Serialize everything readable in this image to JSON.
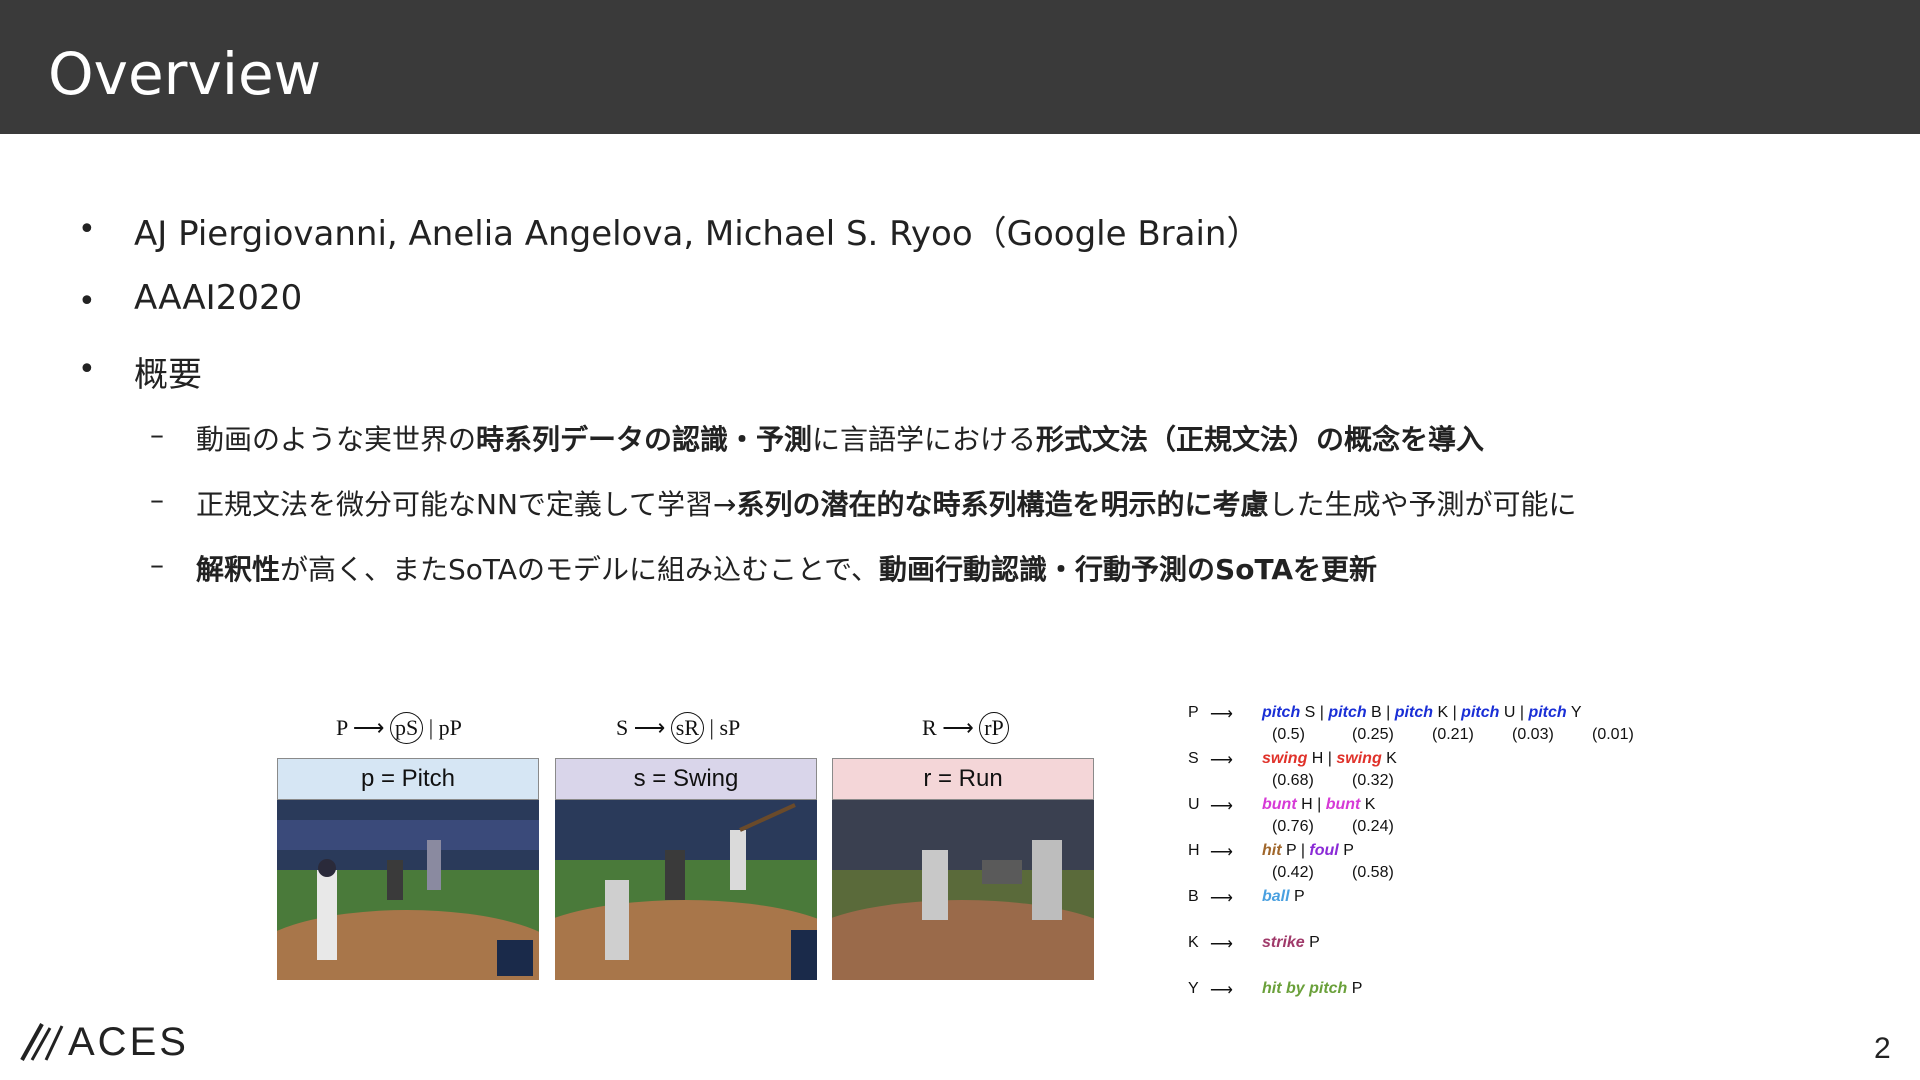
{
  "header": {
    "title": "Overview"
  },
  "bullets": [
    "AJ Piergiovanni, Anelia Angelova, Michael S. Ryoo（Google Brain）",
    "AAAI2020",
    "概要"
  ],
  "sub_bullets": [
    [
      {
        "t": "動画のような実世界の",
        "b": false
      },
      {
        "t": "時系列データの認識・予測",
        "b": true
      },
      {
        "t": "に言語学における",
        "b": false
      },
      {
        "t": "形式文法（正規文法）の概念を導入",
        "b": true
      }
    ],
    [
      {
        "t": "正規文法を微分可能なNNで定義して学習→",
        "b": false
      },
      {
        "t": "系列の潜在的な時系列構造を明示的に考慮",
        "b": true
      },
      {
        "t": "した生成や予測が可能に",
        "b": false
      }
    ],
    [
      {
        "t": "解釈性",
        "b": true
      },
      {
        "t": "が高く、またSoTAのモデルに組み込むことで、",
        "b": false
      },
      {
        "t": "動画行動認識・行動予測のSoTAを更新",
        "b": true
      }
    ]
  ],
  "figure": {
    "panels": [
      {
        "rule_lhs": "P",
        "rule_circle": "pS",
        "rule_rest": "| pP",
        "label": "p = Pitch",
        "color": "#d6e6f4"
      },
      {
        "rule_lhs": "S",
        "rule_circle": "sR",
        "rule_rest": "| sP",
        "label": "s = Swing",
        "color": "#d9d5ea"
      },
      {
        "rule_lhs": "R",
        "rule_circle": "rP",
        "rule_rest": "",
        "label": "r = Run",
        "color": "#f4d6d8"
      }
    ],
    "grammar": [
      {
        "nt": "P",
        "prods": [
          {
            "kw": "pitch",
            "color": "#1a2fd6",
            "sym": "S"
          },
          {
            "kw": "pitch",
            "color": "#1a2fd6",
            "sym": "B"
          },
          {
            "kw": "pitch",
            "color": "#1a2fd6",
            "sym": "K"
          },
          {
            "kw": "pitch",
            "color": "#1a2fd6",
            "sym": "U"
          },
          {
            "kw": "pitch",
            "color": "#1a2fd6",
            "sym": "Y"
          }
        ],
        "probs": [
          "(0.5)",
          "(0.25)",
          "(0.21)",
          "(0.03)",
          "(0.01)"
        ]
      },
      {
        "nt": "S",
        "prods": [
          {
            "kw": "swing",
            "color": "#e0322a",
            "sym": "H"
          },
          {
            "kw": "swing",
            "color": "#e0322a",
            "sym": "K"
          }
        ],
        "probs": [
          "(0.68)",
          "(0.32)"
        ]
      },
      {
        "nt": "U",
        "prods": [
          {
            "kw": "bunt",
            "color": "#d63ad6",
            "sym": "H"
          },
          {
            "kw": "bunt",
            "color": "#d63ad6",
            "sym": "K"
          }
        ],
        "probs": [
          "(0.76)",
          "(0.24)"
        ]
      },
      {
        "nt": "H",
        "prods": [
          {
            "kw": "hit",
            "color": "#a0662a",
            "sym": "P"
          },
          {
            "kw": "foul",
            "color": "#8a2ad6",
            "sym": "P"
          }
        ],
        "probs": [
          "(0.42)",
          "(0.58)"
        ]
      },
      {
        "nt": "B",
        "prods": [
          {
            "kw": "ball",
            "color": "#4aa0e0",
            "sym": "P"
          }
        ],
        "probs": []
      },
      {
        "nt": "K",
        "prods": [
          {
            "kw": "strike",
            "color": "#a03a6a",
            "sym": "P"
          }
        ],
        "probs": []
      },
      {
        "nt": "Y",
        "prods": [
          {
            "kw": "hit by pitch",
            "color": "#6aa03a",
            "sym": "P"
          }
        ],
        "probs": []
      }
    ]
  },
  "footer": {
    "logo_text": "ACES",
    "page_number": "2"
  }
}
